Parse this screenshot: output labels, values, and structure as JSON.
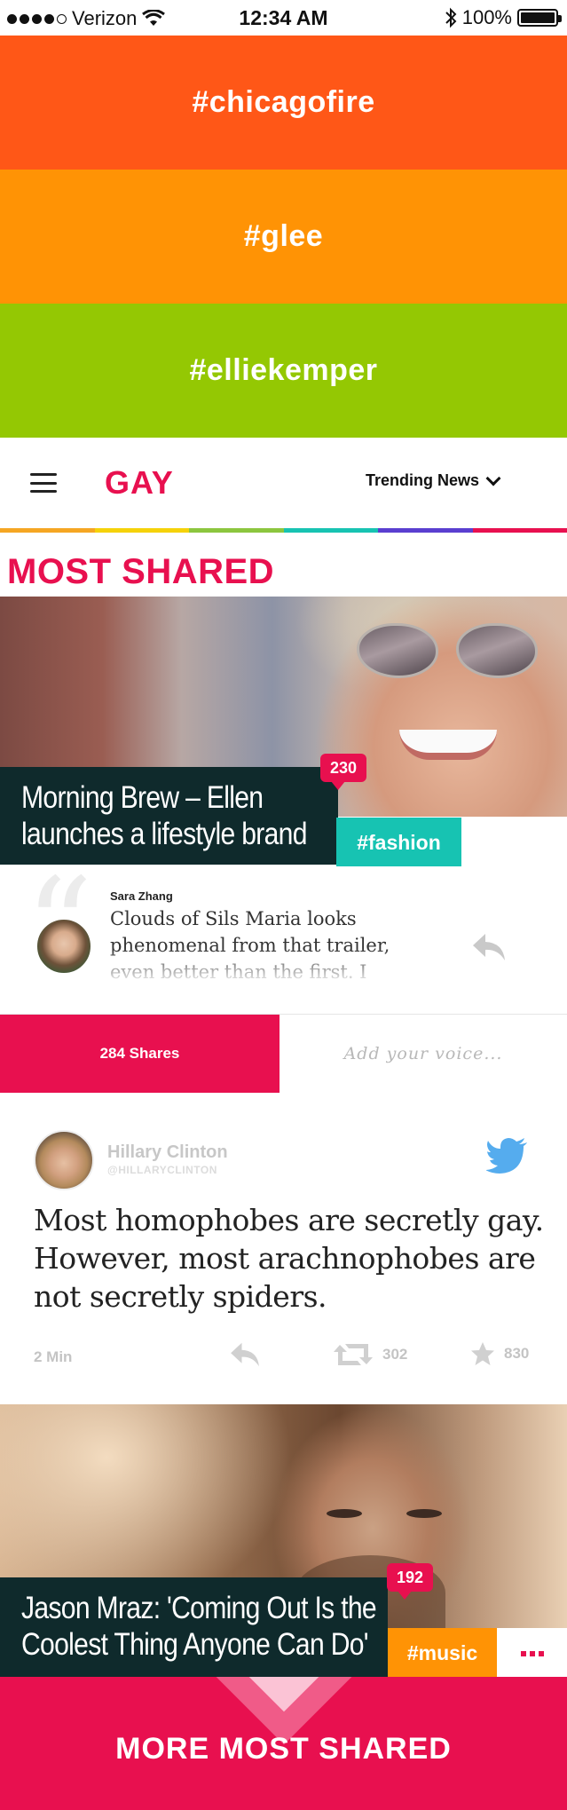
{
  "status_bar": {
    "carrier": "Verizon",
    "time": "12:34 AM",
    "battery": "100%",
    "battery_level": 1.0,
    "signal_filled": 4,
    "signal_total": 5
  },
  "hashtag_bands": [
    {
      "label": "#chicagofire",
      "color": "#ff5717"
    },
    {
      "label": "#glee",
      "color": "#ff9305"
    },
    {
      "label": "#elliekemper",
      "color": "#94c803"
    }
  ],
  "nav": {
    "logo": "GAY",
    "logo_color": "#e8104f",
    "dropdown_label": "Trending News",
    "rainbow": [
      "#f5a623",
      "#f5d20a",
      "#8cc63f",
      "#17c3b2",
      "#5a3fd0",
      "#e8104f"
    ]
  },
  "section_title": {
    "label": "MOST SHARED",
    "color": "#e8104f"
  },
  "articles": [
    {
      "headline_lines": [
        "Morning Brew – Ellen",
        "launches a lifestyle brand"
      ],
      "tag": "#fashion",
      "tag_color": "#17c3b2",
      "count": "230"
    },
    {
      "headline_lines": [
        "Jason Mraz: 'Coming Out Is the",
        "Coolest Thing Anyone Can Do'"
      ],
      "tag": "#music",
      "tag_color": "#ff9305",
      "count": "192"
    }
  ],
  "comment": {
    "author": "Sara Zhang",
    "text": "Clouds of Sils Maria looks phenomenal from that trailer, even better than the first. I hope"
  },
  "shares": {
    "label": "284 Shares",
    "placeholder": "Add your voice..."
  },
  "tweet": {
    "name": "Hillary Clinton",
    "handle": "@HILLARYCLINTON",
    "text": "Most homophobes are secretly gay. However, most arachnophobes are not secretly spiders.",
    "time": "2 Min",
    "retweets": "302",
    "favorites": "830",
    "bird_color": "#55acee"
  },
  "more_button": {
    "label": "MORE MOST SHARED"
  },
  "colors": {
    "accent": "#e8104f",
    "dark": "#0f2a2c"
  }
}
